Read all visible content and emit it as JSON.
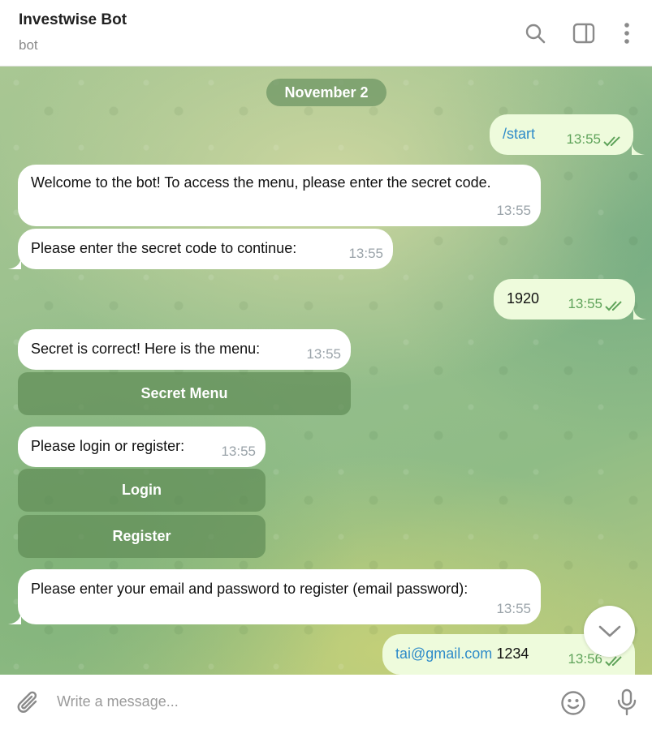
{
  "header": {
    "title": "Investwise Bot",
    "subtitle": "bot",
    "icons": [
      "search-icon",
      "sidebar-toggle-icon",
      "more-vertical-icon"
    ]
  },
  "chat": {
    "date": "November 2",
    "messages": [
      {
        "direction": "out",
        "text": "/start",
        "time": "13:55",
        "status": "read"
      },
      {
        "direction": "in",
        "text": "Welcome to the bot! To access the menu, please enter the secret code.",
        "time": "13:55"
      },
      {
        "direction": "in",
        "text": "Please enter the secret code to continue:",
        "time": "13:55"
      },
      {
        "direction": "out",
        "text": "1920",
        "time": "13:55",
        "status": "read"
      },
      {
        "direction": "in",
        "text": "Secret is correct! Here is the menu:",
        "time": "13:55",
        "buttons": [
          "Secret Menu"
        ]
      },
      {
        "direction": "in",
        "text": "Please login or register:",
        "time": "13:55",
        "buttons": [
          "Login",
          "Register"
        ]
      },
      {
        "direction": "in",
        "text": "Please enter your email and password to register (email password):",
        "time": "13:55"
      },
      {
        "direction": "out",
        "email": "tai@gmail.com",
        "rest": " 1234",
        "time": "13:56",
        "status": "read"
      }
    ]
  },
  "composer": {
    "placeholder": "Write a message...",
    "icons": [
      "attach-icon",
      "emoji-icon",
      "microphone-icon"
    ]
  },
  "colors": {
    "incoming_bubble": "#ffffff",
    "outgoing_bubble": "#eefbdc",
    "outgoing_time": "#5fa35a",
    "link": "#2e8bc9"
  }
}
